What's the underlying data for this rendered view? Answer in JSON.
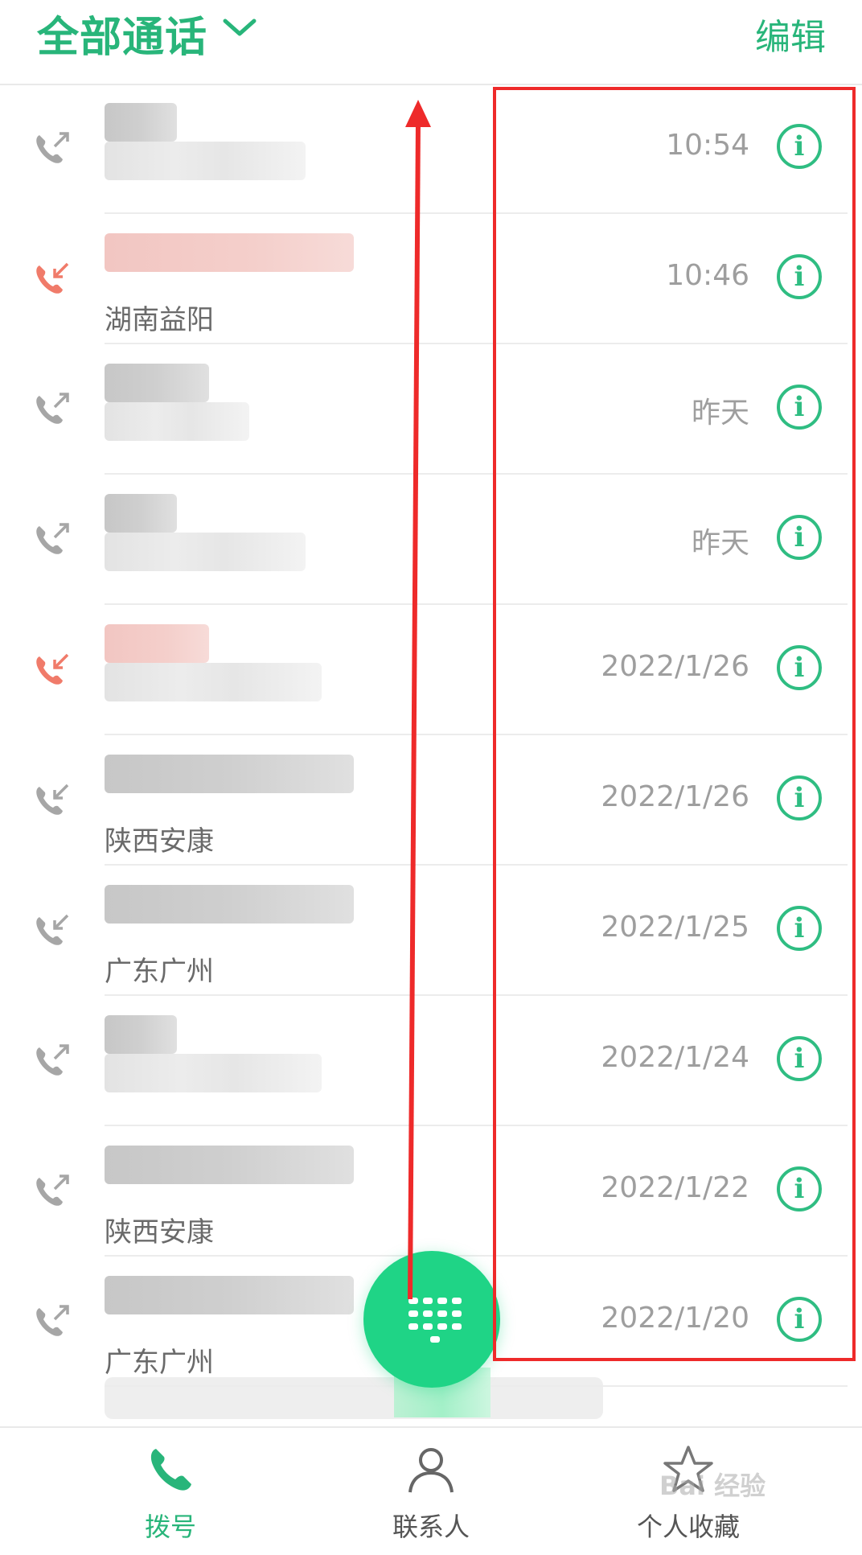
{
  "header": {
    "title": "全部通话",
    "edit_label": "编辑"
  },
  "calls": [
    {
      "direction": "outgoing",
      "missed": false,
      "location": "",
      "time": "10:54"
    },
    {
      "direction": "incoming",
      "missed": true,
      "location": "湖南益阳",
      "time": "10:46"
    },
    {
      "direction": "outgoing",
      "missed": false,
      "location": "",
      "time": "昨天"
    },
    {
      "direction": "outgoing",
      "missed": false,
      "location": "",
      "time": "昨天"
    },
    {
      "direction": "incoming",
      "missed": true,
      "location": "",
      "time": "2022/1/26"
    },
    {
      "direction": "incoming",
      "missed": false,
      "location": "陕西安康",
      "time": "2022/1/26"
    },
    {
      "direction": "incoming",
      "missed": false,
      "location": "广东广州",
      "time": "2022/1/25"
    },
    {
      "direction": "outgoing",
      "missed": false,
      "location": "",
      "time": "2022/1/24"
    },
    {
      "direction": "outgoing",
      "missed": false,
      "location": "陕西安康",
      "time": "2022/1/22"
    },
    {
      "direction": "outgoing",
      "missed": false,
      "location": "广东广州",
      "time": "2022/1/20"
    }
  ],
  "info_glyph": "i",
  "tabs": [
    {
      "label": "拨号",
      "icon": "phone-icon",
      "active": true
    },
    {
      "label": "联系人",
      "icon": "person-icon",
      "active": false
    },
    {
      "label": "个人收藏",
      "icon": "star-icon",
      "active": false
    }
  ],
  "fab": {
    "icon": "dialpad-icon"
  },
  "watermark": "Bai 经验",
  "colors": {
    "accent": "#28b57a",
    "missed": "#f07b6a",
    "annotation": "#ee2a2a",
    "fab": "#1fd486"
  }
}
